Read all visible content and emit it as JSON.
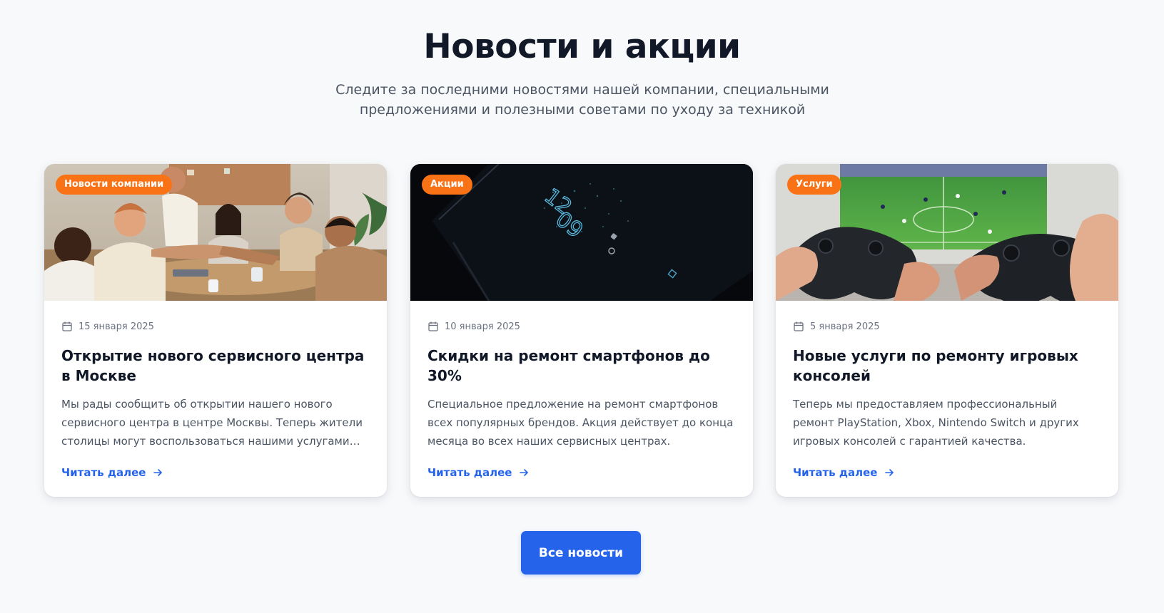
{
  "header": {
    "title": "Новости и акции",
    "subtitle": "Следите за последними новостями нашей компании, специальными предложениями и полезными советами по уходу за техникой"
  },
  "cards": [
    {
      "badge": "Новости компании",
      "date": "15 января 2025",
      "title": "Открытие нового сервисного центра в Москве",
      "text": "Мы рады сообщить об открытии нашего нового сервисного центра в центре Москвы. Теперь жители столицы могут воспользоваться нашими услугами еще быстрее и удобнее.",
      "link": "Читать далее",
      "image": "team-meeting-handshake-photo"
    },
    {
      "badge": "Акции",
      "date": "10 января 2025",
      "title": "Скидки на ремонт смартфонов до 30%",
      "text": "Специальное предложение на ремонт смартфонов всех популярных брендов. Акция действует до конца месяца во всех наших сервисных центрах.",
      "link": "Читать далее",
      "image": "smartphone-lockscreen-photo"
    },
    {
      "badge": "Услуги",
      "date": "5 января 2025",
      "title": "Новые услуги по ремонту игровых консолей",
      "text": "Теперь мы предоставляем профессиональный ремонт PlayStation, Xbox, Nintendo Switch и других игровых консолей с гарантией качества.",
      "link": "Читать далее",
      "image": "gamepad-football-game-photo"
    }
  ],
  "phone_clock": {
    "hours": "12",
    "minutes": "09"
  },
  "all_news_button": "Все новости",
  "colors": {
    "accent": "#2563eb",
    "badge": "#f97316",
    "background": "#f8f9fb",
    "text_dark": "#111827",
    "text_muted": "#4b5563"
  }
}
